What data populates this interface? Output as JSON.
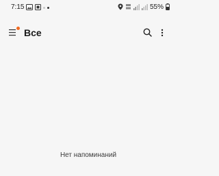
{
  "status_bar": {
    "time": "7:15",
    "battery": "55%",
    "icons": {
      "left": [
        "photo-icon",
        "sim-card-icon",
        "dot-light",
        "dot"
      ],
      "right": [
        "location-icon",
        "volte-icon",
        "signal-icon",
        "signal-icon",
        "battery-icon"
      ]
    }
  },
  "app_bar": {
    "title": "Все",
    "menu_icon": "hamburger-menu-icon",
    "badge_color": "#f26a21",
    "search_icon": "search-icon",
    "more_icon": "more-vertical-icon"
  },
  "main": {
    "empty_message": "Нет напоминаний"
  }
}
